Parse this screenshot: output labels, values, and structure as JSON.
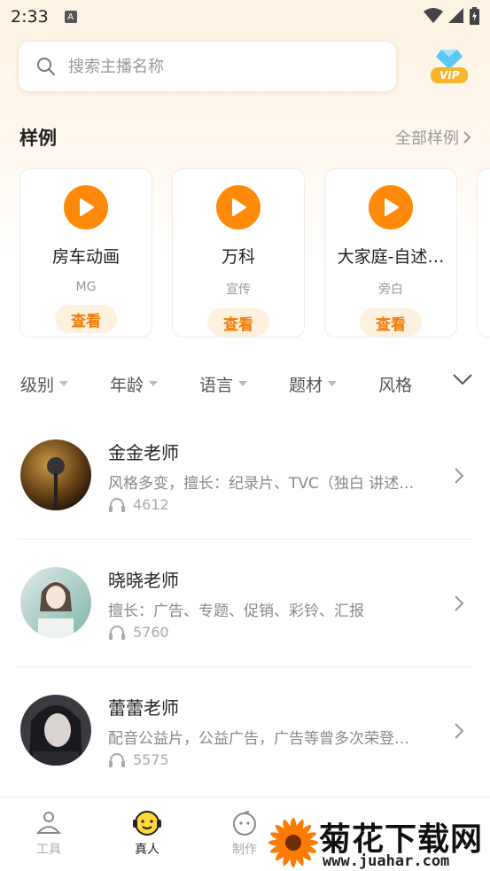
{
  "status": {
    "time": "2:33",
    "notif_letter": "A"
  },
  "search": {
    "placeholder": "搜索主播名称"
  },
  "vip": {
    "label": "VIP"
  },
  "samples": {
    "title": "样例",
    "more": "全部样例",
    "cards": [
      {
        "title": "房车动画",
        "sub": "MG",
        "button": "查看"
      },
      {
        "title": "万科",
        "sub": "宣传",
        "button": "查看"
      },
      {
        "title": "大家庭-自述…",
        "sub": "旁白",
        "button": "查看"
      }
    ]
  },
  "filters": [
    "级别",
    "年龄",
    "语言",
    "题材",
    "风格"
  ],
  "teachers": [
    {
      "name": "金金老师",
      "desc": "风格多变，擅长：纪录片、TVC（独白 讲述…",
      "plays": "4612"
    },
    {
      "name": "晓晓老师",
      "desc": "擅长：广告、专题、促销、彩铃、汇报",
      "plays": "5760"
    },
    {
      "name": "蕾蕾老师",
      "desc": "配音公益片，公益广告，广告等曾多次荣登…",
      "plays": "5575"
    }
  ],
  "tabs": [
    {
      "label": "工具",
      "icon": "tool-icon"
    },
    {
      "label": "真人",
      "icon": "face-icon",
      "active": true
    },
    {
      "label": "制作",
      "icon": "make-icon"
    }
  ],
  "watermark": {
    "text": "菊花下载网",
    "url": "www.juahar.com"
  },
  "colors": {
    "accent": "#ff8a0a",
    "accent_bg": "#fff1e0"
  }
}
